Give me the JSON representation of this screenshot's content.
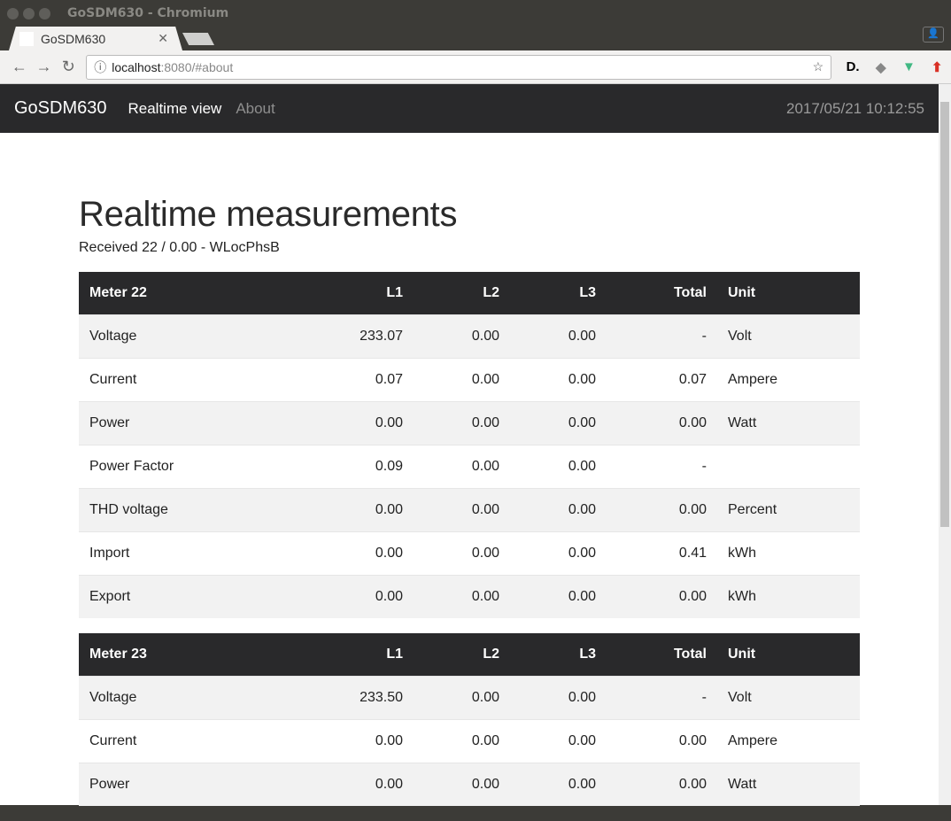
{
  "browser": {
    "window_title": "GoSDM630 - Chromium",
    "tab_title": "GoSDM630",
    "url_host": "localhost",
    "url_rest": ":8080/#about"
  },
  "navbar": {
    "brand": "GoSDM630",
    "links": [
      "Realtime view",
      "About"
    ],
    "clock": "2017/05/21 10:12:55"
  },
  "main": {
    "title": "Realtime measurements",
    "status": "Received 22 / 0.00 - WLocPhsB",
    "columns": [
      "L1",
      "L2",
      "L3",
      "Total",
      "Unit"
    ],
    "meters": [
      {
        "name": "Meter 22",
        "rows": [
          [
            "Voltage",
            "233.07",
            "0.00",
            "0.00",
            "-",
            "Volt"
          ],
          [
            "Current",
            "0.07",
            "0.00",
            "0.00",
            "0.07",
            "Ampere"
          ],
          [
            "Power",
            "0.00",
            "0.00",
            "0.00",
            "0.00",
            "Watt"
          ],
          [
            "Power Factor",
            "0.09",
            "0.00",
            "0.00",
            "-",
            ""
          ],
          [
            "THD voltage",
            "0.00",
            "0.00",
            "0.00",
            "0.00",
            "Percent"
          ],
          [
            "Import",
            "0.00",
            "0.00",
            "0.00",
            "0.41",
            "kWh"
          ],
          [
            "Export",
            "0.00",
            "0.00",
            "0.00",
            "0.00",
            "kWh"
          ]
        ]
      },
      {
        "name": "Meter 23",
        "rows": [
          [
            "Voltage",
            "233.50",
            "0.00",
            "0.00",
            "-",
            "Volt"
          ],
          [
            "Current",
            "0.00",
            "0.00",
            "0.00",
            "0.00",
            "Ampere"
          ],
          [
            "Power",
            "0.00",
            "0.00",
            "0.00",
            "0.00",
            "Watt"
          ]
        ]
      }
    ]
  }
}
